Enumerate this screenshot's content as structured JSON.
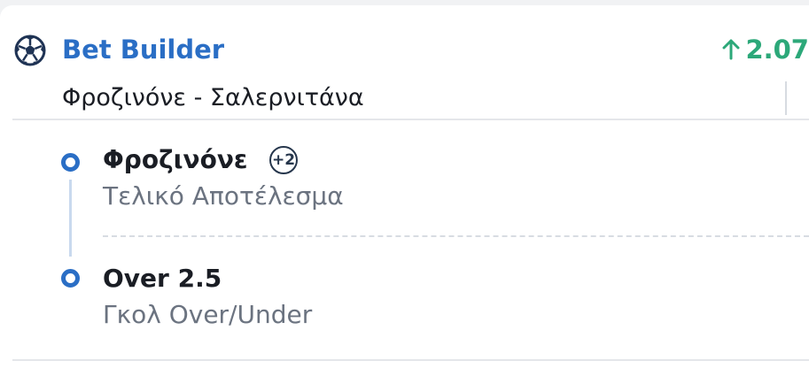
{
  "header": {
    "icon": "soccer-ball-icon",
    "title": "Bet Builder",
    "odds_direction_icon": "arrow-up-icon",
    "odds": "2.07",
    "match": "Φροζινόνε - Σαλερνιτάνα"
  },
  "selections": [
    {
      "name": "Φροζινόνε",
      "badge": "+2",
      "market": "Τελικό Αποτέλεσμα"
    },
    {
      "name": "Over 2.5",
      "market": "Γκολ Over/Under"
    }
  ],
  "colors": {
    "accent": "#2a6ec5",
    "odds_up": "#2ca879",
    "text_primary": "#1a1d24",
    "text_secondary": "#6b7380"
  }
}
